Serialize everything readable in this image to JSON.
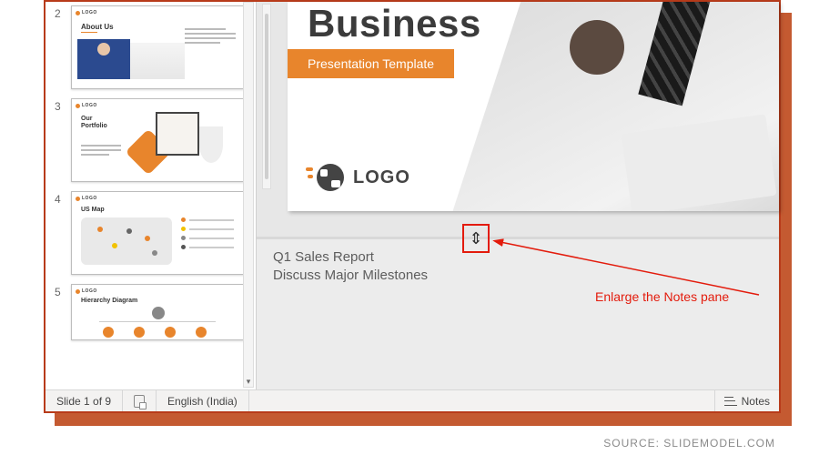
{
  "thumbnails": [
    {
      "num": "2",
      "title": "About Us",
      "logo": "LOGO"
    },
    {
      "num": "3",
      "title": "Our\nPortfolio",
      "logo": "LOGO"
    },
    {
      "num": "4",
      "title": "US Map",
      "logo": "LOGO"
    },
    {
      "num": "5",
      "title": "Hierarchy Diagram",
      "logo": "LOGO"
    }
  ],
  "slide": {
    "headline": "Business",
    "subtitle": "Presentation Template",
    "logo_text": "LOGO"
  },
  "notes": {
    "text": "Q1 Sales Report\nDiscuss Major Milestones"
  },
  "annotation": {
    "resize_glyph": "⇕",
    "callout": "Enlarge the Notes pane"
  },
  "statusbar": {
    "slide_counter": "Slide 1 of 9",
    "language": "English (India)",
    "notes_label": "Notes"
  },
  "source": "SOURCE: SLIDEMODEL.COM",
  "colors": {
    "accent": "#e8852c",
    "annotation": "#e31b0c",
    "frame": "#b83b1a"
  }
}
